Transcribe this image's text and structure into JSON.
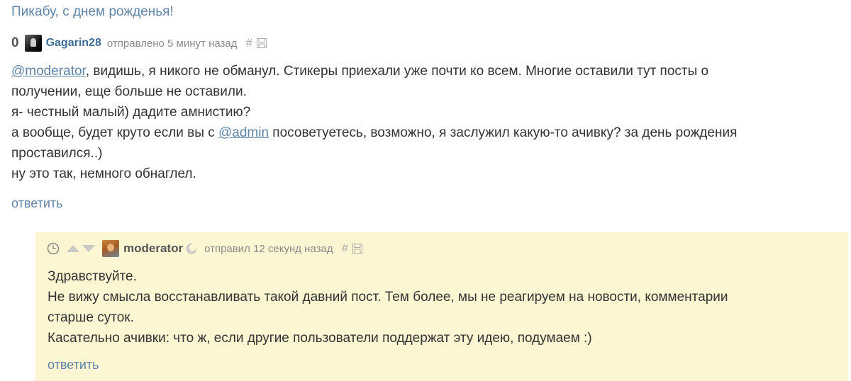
{
  "post": {
    "title": "Пикабу, с днем рожденья!"
  },
  "comment1": {
    "rating": "0",
    "username": "Gagarin28",
    "meta": "отправлено 5 минут назад",
    "hash": "#",
    "mention1": "@moderator",
    "line1_rest": ", видишь, я никого не обманул. Стикеры приехали уже почти ко всем. Многие оставили тут посты о",
    "line2": "получении, еще больше не оставили.",
    "line3": "я- честный малый) дадите амнистию?",
    "line4_pre": "а вообще, будет круто если вы с ",
    "mention2": "@admin",
    "line4_post": " посоветуетесь, возможно, я заслужил какую-то ачивку? за день рождения",
    "line5": "проставился..)",
    "line6": "ну это так, немного обнаглел.",
    "reply": "ответить"
  },
  "comment2": {
    "username": "moderator",
    "meta": "отправил 12 секунд назад",
    "hash": "#",
    "line1": "Здравствуйте.",
    "line2": "Не вижу смысла восстанавливать такой давний пост. Тем более, мы не реагируем на новости, комментарии",
    "line3": "старше суток.",
    "line4": "Касательно ачивки: что ж, если другие пользователи поддержат эту идею, подумаем :)",
    "reply": "ответить"
  },
  "colors": {
    "link": "#5f84a8",
    "username": "#3d6b99",
    "reply_bg": "#fcf6d2"
  }
}
